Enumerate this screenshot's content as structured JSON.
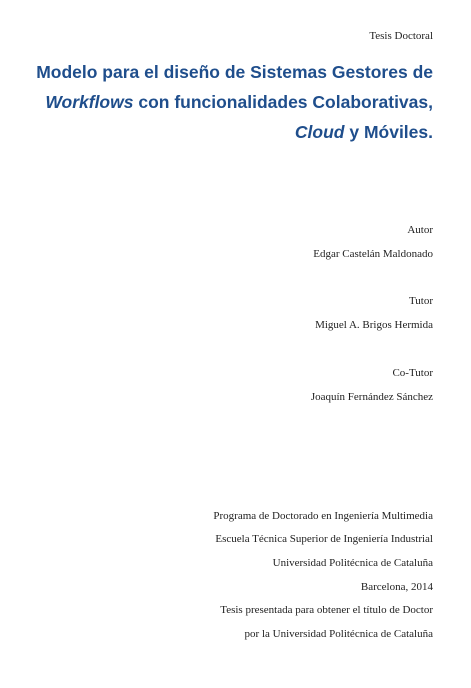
{
  "header": {
    "doc_type": "Tesis Doctoral"
  },
  "title": {
    "line1": "Modelo para el diseño de Sistemas Gestores de",
    "line2_italic": "Workflows",
    "line2_rest": " con funcionalidades Colaborativas,",
    "line3_italic": "Cloud",
    "line3_rest": " y Móviles."
  },
  "author": {
    "label": "Autor",
    "name": "Edgar Castelán Maldonado"
  },
  "tutor": {
    "label": "Tutor",
    "name": "Miguel A. Brigos Hermida"
  },
  "cotutor": {
    "label": "Co-Tutor",
    "name": "Joaquín Fernández Sánchez"
  },
  "footer": {
    "program": "Programa de Doctorado en Ingeniería Multimedia",
    "school": "Escuela Técnica Superior de Ingeniería Industrial",
    "university": "Universidad Politécnica de Cataluña",
    "place_date": "Barcelona, 2014",
    "purpose_line1": "Tesis presentada para obtener el título de Doctor",
    "purpose_line2": "por la Universidad Politécnica de Cataluña"
  }
}
